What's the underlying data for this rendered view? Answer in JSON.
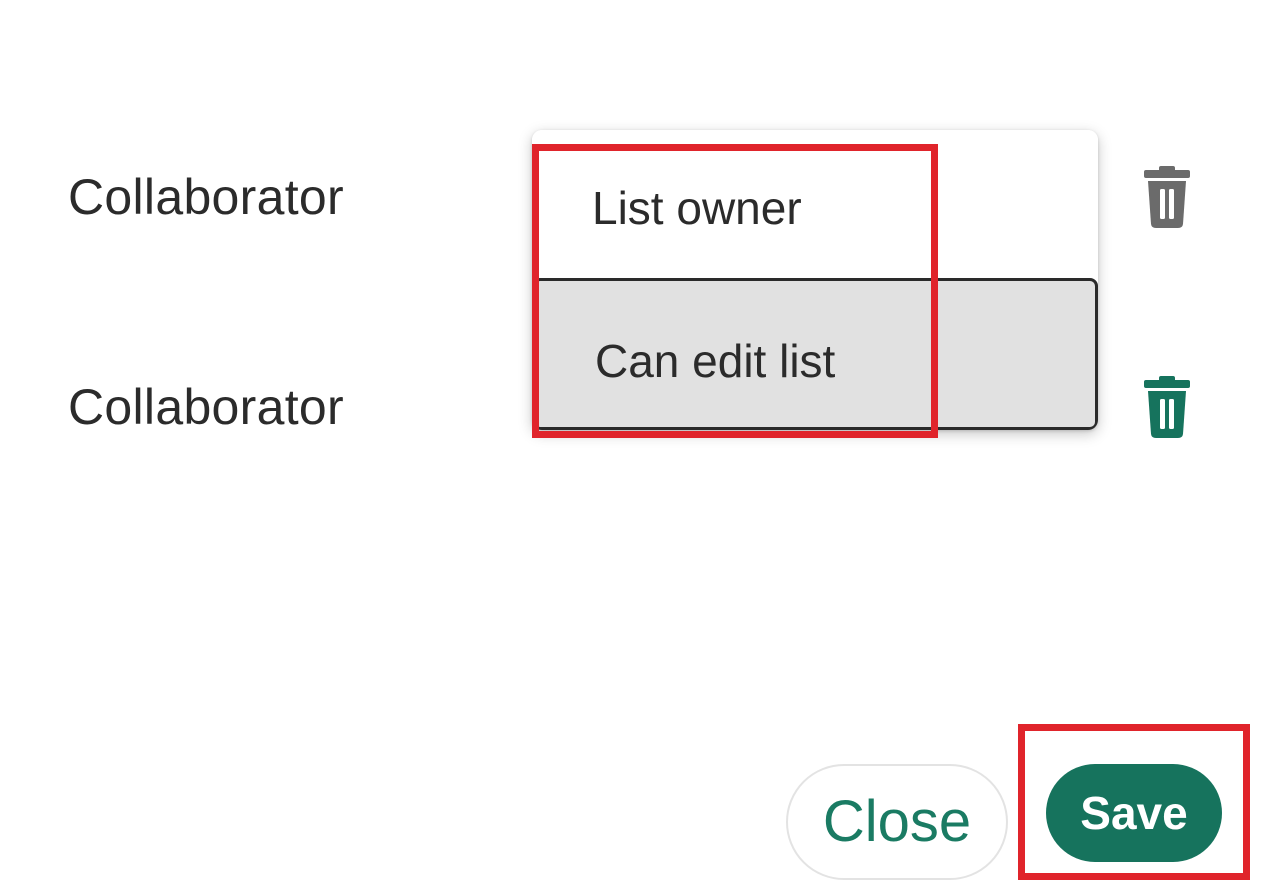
{
  "colors": {
    "accent": "#16735d",
    "accent_text": "#1a7b63",
    "highlight": "#e0242b",
    "trash_inactive": "#6b6b6b",
    "selected_option_bg": "#e1e1e1"
  },
  "collaborators": [
    {
      "role_label": "Collaborator",
      "delete_icon": "trash-icon",
      "delete_icon_color": "#6b6b6b"
    },
    {
      "role_label": "Collaborator",
      "delete_icon": "trash-icon",
      "delete_icon_color": "#16735d"
    }
  ],
  "permission_dropdown": {
    "options": [
      {
        "label": "List owner",
        "selected": false
      },
      {
        "label": "Can edit list",
        "selected": true
      }
    ]
  },
  "footer": {
    "close_label": "Close",
    "save_label": "Save"
  }
}
